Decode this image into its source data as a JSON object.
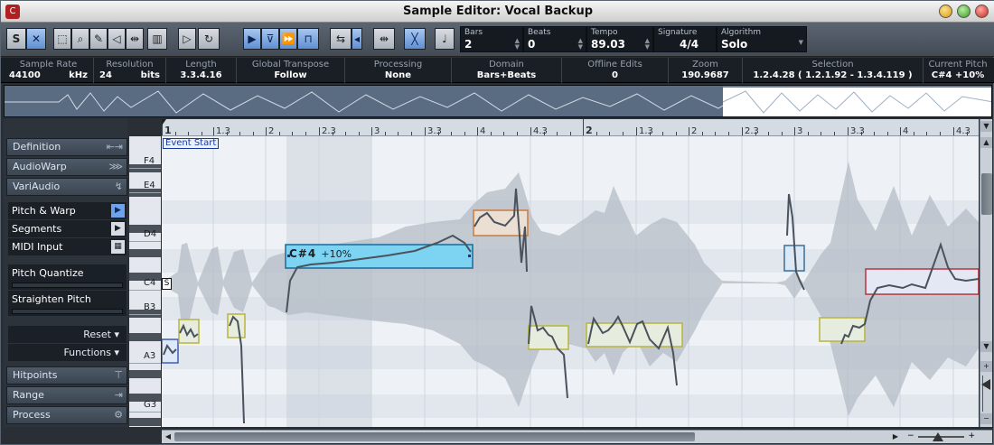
{
  "window": {
    "title": "Sample Editor: Vocal Backup"
  },
  "toolbar": {
    "solo_icon": "solo-editor-icon",
    "fields": [
      {
        "label": "Bars",
        "value": "2"
      },
      {
        "label": "Beats",
        "value": "0"
      },
      {
        "label": "Tempo",
        "value": "89.03"
      },
      {
        "label": "Signature",
        "value": "4/4"
      },
      {
        "label": "Algorithm",
        "value": "Solo"
      }
    ]
  },
  "infoline": [
    {
      "label": "Sample Rate",
      "value": "44100",
      "unit": "kHz"
    },
    {
      "label": "Resolution",
      "value": "24",
      "unit": "bits"
    },
    {
      "label": "Length",
      "value": "3.3.4.16"
    },
    {
      "label": "Global Transpose",
      "value": "Follow"
    },
    {
      "label": "Processing",
      "value": "None"
    },
    {
      "label": "Domain",
      "value": "Bars+Beats"
    },
    {
      "label": "Offline Edits",
      "value": "0"
    },
    {
      "label": "Zoom",
      "value": "190.9687"
    },
    {
      "label": "Selection",
      "value": "1.2.4.28 ( 1.2.1.92 - 1.3.4.119 )"
    },
    {
      "label": "Current Pitch",
      "value": "C#4 +10%"
    }
  ],
  "leftpanel": {
    "sections": [
      "Definition",
      "AudioWarp",
      "VariAudio"
    ],
    "modes": [
      {
        "label": "Pitch & Warp",
        "active": true
      },
      {
        "label": "Segments",
        "active": false
      },
      {
        "label": "MIDI Input",
        "active": false
      }
    ],
    "pitch_quantize": "Pitch Quantize",
    "straighten_pitch": "Straighten Pitch",
    "reset": "Reset",
    "functions": "Functions",
    "bottom_sections": [
      "Hitpoints",
      "Range",
      "Process"
    ]
  },
  "ruler": {
    "ticks": [
      "1",
      "1.3",
      "2",
      "2.3",
      "3",
      "3.3",
      "4",
      "4.3",
      "2",
      "1.3",
      "2",
      "2.3",
      "3",
      "3.3",
      "4",
      "4.3"
    ]
  },
  "keys": {
    "labels": [
      "F4",
      "E4",
      "D4",
      "C4",
      "B3",
      "A3",
      "G3"
    ]
  },
  "editor": {
    "event_start": "Event Start",
    "selected_segment_pitch": "C#4",
    "selected_segment_dev": "+10%",
    "start_marker": "S"
  },
  "colors": {
    "selected_segment": "#7dd3f2",
    "segment_yellow": "#b8b43a",
    "segment_orange": "#c87c3c",
    "segment_red": "#b8323c",
    "segment_blue": "#3c5cb8"
  }
}
